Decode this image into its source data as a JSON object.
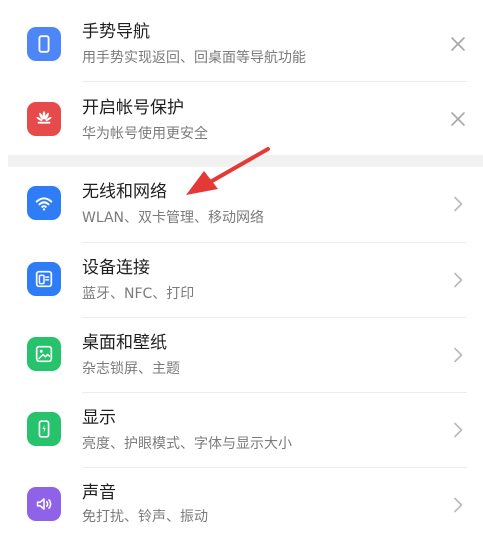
{
  "suggestions": [
    {
      "title": "手势导航",
      "subtitle": "用手势实现返回、回桌面等导航功能",
      "icon": "gesture-phone-icon",
      "icon_color": "#4f86f7",
      "action_icon": "close-icon"
    },
    {
      "title": "开启帐号保护",
      "subtitle": "华为帐号使用更安全",
      "icon": "huawei-logo-icon",
      "icon_color": "#e64a4a",
      "action_icon": "close-icon"
    }
  ],
  "settings": [
    {
      "title": "无线和网络",
      "subtitle": "WLAN、双卡管理、移动网络",
      "icon": "wifi-icon",
      "icon_color": "#2f7df6"
    },
    {
      "title": "设备连接",
      "subtitle": "蓝牙、NFC、打印",
      "icon": "device-connection-icon",
      "icon_color": "#2f7df6"
    },
    {
      "title": "桌面和壁纸",
      "subtitle": "杂志锁屏、主题",
      "icon": "wallpaper-icon",
      "icon_color": "#27c26c"
    },
    {
      "title": "显示",
      "subtitle": "亮度、护眼模式、字体与显示大小",
      "icon": "display-icon",
      "icon_color": "#27c26c"
    },
    {
      "title": "声音",
      "subtitle": "免打扰、铃声、振动",
      "icon": "sound-icon",
      "icon_color": "#8e63e8"
    }
  ],
  "colors": {
    "title_text": "#1f1f1f",
    "subtitle_text": "#7b7b7b",
    "divider": "#ececec",
    "section_gap": "#f1f1f1",
    "chevron": "#b9b9b9",
    "annotation_arrow": "#e53935"
  }
}
